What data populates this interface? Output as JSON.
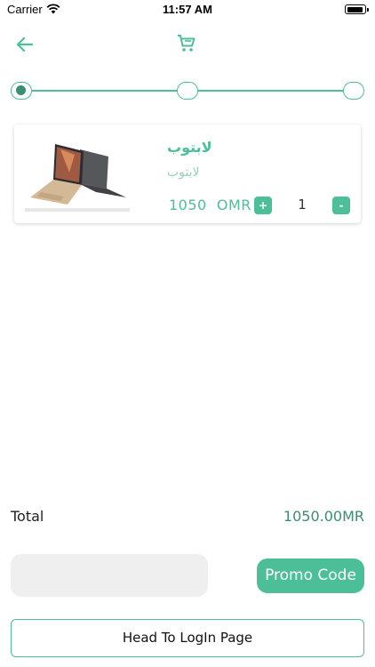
{
  "status_bar": {
    "carrier": "Carrier",
    "time": "11:57 AM",
    "battery_level": 0.95
  },
  "header": {
    "back_icon": "arrow-left-icon",
    "cart_icon": "shopping-cart-icon"
  },
  "stepper": {
    "steps": 3,
    "active_step": 1
  },
  "cart": {
    "items": [
      {
        "title": "لابتوب",
        "subtitle": "لابتوب",
        "price": "1050  OMR",
        "quantity": "1",
        "image": "laptop-image"
      }
    ],
    "plus_label": "+",
    "minus_label": "-"
  },
  "summary": {
    "total_label": "Total",
    "total_value": "1050.00MR"
  },
  "promo": {
    "input_value": "",
    "button_label": "Promo Code"
  },
  "login_button_label": "Head To LogIn Page",
  "colors": {
    "accent": "#4dbf98",
    "accent_dark": "#3a8f73",
    "input_bg": "#efefef"
  }
}
